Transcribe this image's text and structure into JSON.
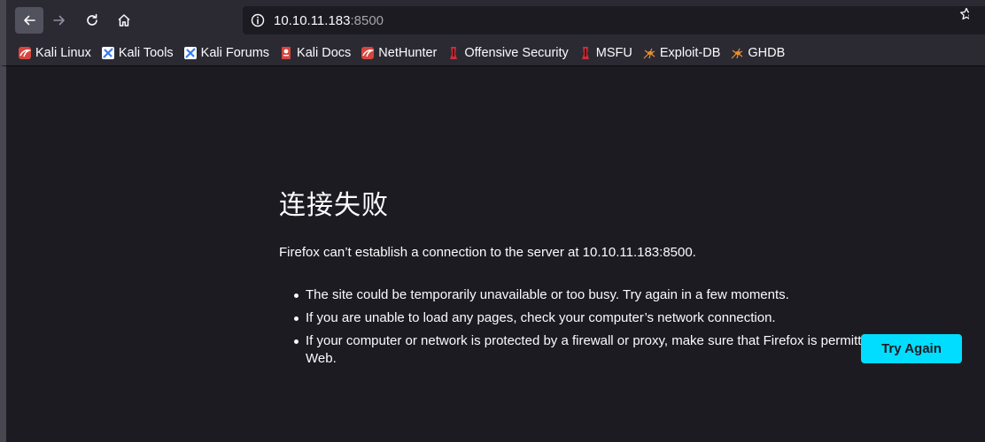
{
  "toolbar": {
    "url_host": "10.10.11.183",
    "url_port": ":8500"
  },
  "bookmarks": [
    {
      "label": "Kali Linux",
      "icon": "kali-dragon-icon"
    },
    {
      "label": "Kali Tools",
      "icon": "kali-tools-icon"
    },
    {
      "label": "Kali Forums",
      "icon": "kali-forums-icon"
    },
    {
      "label": "Kali Docs",
      "icon": "kali-docs-icon"
    },
    {
      "label": "NetHunter",
      "icon": "nethunter-icon"
    },
    {
      "label": "Offensive Security",
      "icon": "offsec-icon"
    },
    {
      "label": "MSFU",
      "icon": "msfu-icon"
    },
    {
      "label": "Exploit-DB",
      "icon": "exploit-db-icon"
    },
    {
      "label": "GHDB",
      "icon": "ghdb-icon"
    }
  ],
  "error": {
    "title": "连接失败",
    "message": "Firefox can’t establish a connection to the server at 10.10.11.183:8500.",
    "reasons": [
      "The site could be temporarily unavailable or too busy. Try again in a few moments.",
      "If you are unable to load any pages, check your computer’s network connection.",
      "If your computer or network is protected by a firewall or proxy, make sure that Firefox is permitted to access the Web."
    ],
    "try_again_label": "Try Again"
  },
  "colors": {
    "toolbar_bg": "#2b2a33",
    "page_bg": "#1c1b22",
    "accent": "#00ddff",
    "text": "#fbfbfe"
  }
}
